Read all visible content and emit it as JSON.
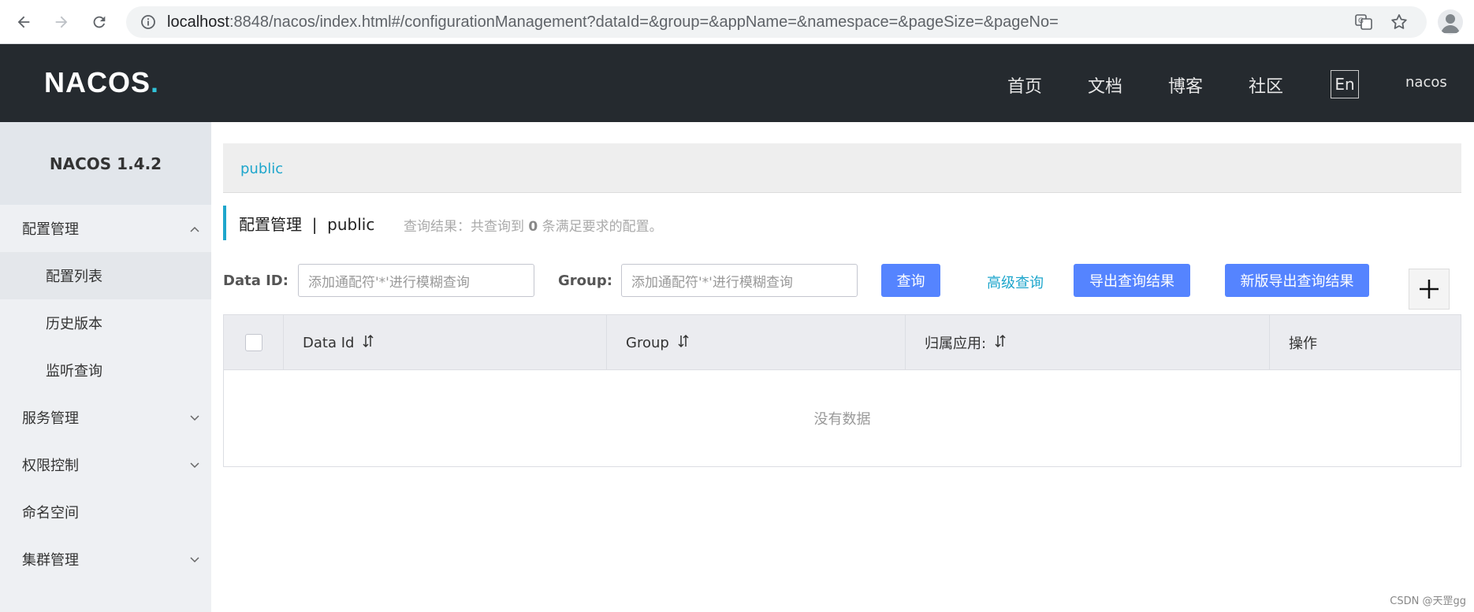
{
  "browser": {
    "url_host": "localhost",
    "url_rest": ":8848/nacos/index.html#/configurationManagement?dataId=&group=&appName=&namespace=&pageSize=&pageNo="
  },
  "header": {
    "logo_main": "NACOS",
    "logo_dot": ".",
    "nav": [
      "首页",
      "文档",
      "博客",
      "社区"
    ],
    "lang": "En",
    "user": "nacos",
    "bg_color": "#252a2f"
  },
  "sidebar": {
    "title": "NACOS 1.4.2",
    "items": [
      {
        "label": "配置管理",
        "expanded": true
      },
      {
        "label": "配置列表",
        "sub": true,
        "active": true
      },
      {
        "label": "历史版本",
        "sub": true
      },
      {
        "label": "监听查询",
        "sub": true
      },
      {
        "label": "服务管理",
        "expanded": false
      },
      {
        "label": "权限控制",
        "expanded": false
      },
      {
        "label": "命名空间"
      },
      {
        "label": "集群管理",
        "expanded": false
      }
    ]
  },
  "main": {
    "breadcrumb": "public",
    "title": "配置管理  |  public",
    "summary_prefix": "查询结果：共查询到 ",
    "summary_count": "0",
    "summary_suffix": " 条满足要求的配置。",
    "dataid_label": "Data ID:",
    "dataid_placeholder": "添加通配符'*'进行模糊查询",
    "group_label": "Group:",
    "group_placeholder": "添加通配符'*'进行模糊查询",
    "search_btn": "查询",
    "advanced_btn": "高级查询",
    "export_btn": "导出查询结果",
    "export_new_btn": "新版导出查询结果",
    "accent": "#5584ff",
    "link_color": "#1ea6cc"
  },
  "table": {
    "columns": [
      "Data Id",
      "Group",
      "归属应用:",
      "操作"
    ],
    "empty_text": "没有数据"
  },
  "watermark": "CSDN @天罡gg"
}
